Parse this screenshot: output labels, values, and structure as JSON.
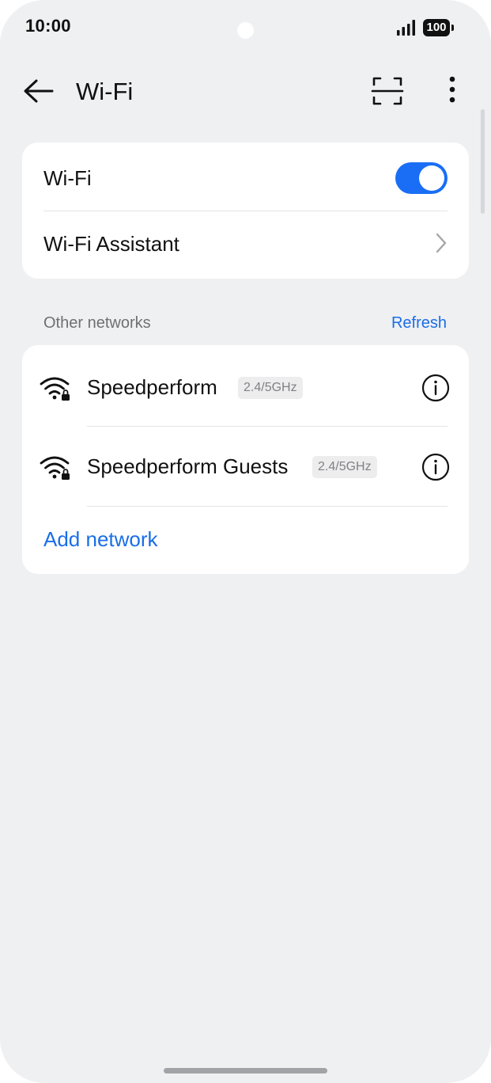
{
  "status_bar": {
    "time": "10:00",
    "battery": "100",
    "signal_icon": "cellular-signal-icon"
  },
  "header": {
    "title": "Wi-Fi",
    "back_icon": "back-arrow-icon",
    "scan_icon": "qr-scan-icon",
    "more_icon": "more-vertical-icon"
  },
  "settings": {
    "wifi_label": "Wi-Fi",
    "wifi_enabled": true,
    "assistant_label": "Wi-Fi Assistant"
  },
  "networks_section": {
    "label": "Other networks",
    "refresh_label": "Refresh",
    "networks": [
      {
        "name": "Speedperform",
        "band": "2.4/5GHz",
        "secured": true
      },
      {
        "name": "Speedperform Guests",
        "band": "2.4/5GHz",
        "secured": true
      }
    ],
    "add_network_label": "Add network"
  },
  "colors": {
    "accent": "#1a6ef5",
    "link": "#1a6ee8",
    "background": "#eff0f2",
    "card": "#ffffff"
  }
}
